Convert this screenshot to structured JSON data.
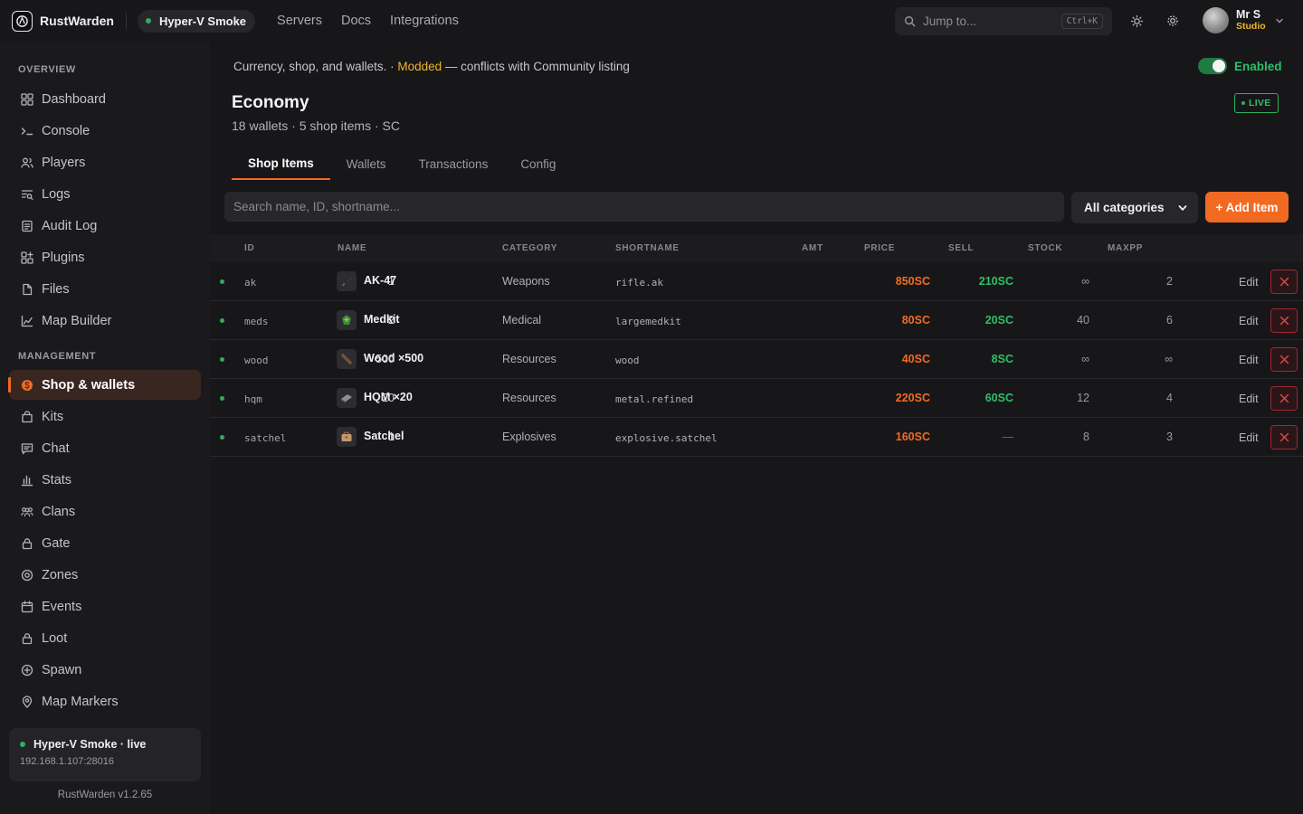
{
  "app": {
    "name": "RustWarden",
    "version": "RustWarden v1.2.65"
  },
  "header": {
    "server_name": "Hyper-V Smoke",
    "nav": [
      "Servers",
      "Docs",
      "Integrations"
    ],
    "jump_placeholder": "Jump to...",
    "jump_shortcut": "Ctrl+K",
    "user": {
      "name": "Mr S",
      "role": "Studio"
    }
  },
  "sidebar": {
    "overview_label": "OVERVIEW",
    "overview_items": [
      {
        "label": "Dashboard",
        "icon": "grid-icon"
      },
      {
        "label": "Console",
        "icon": "terminal-icon"
      },
      {
        "label": "Players",
        "icon": "users-icon"
      },
      {
        "label": "Logs",
        "icon": "logs-search-icon"
      },
      {
        "label": "Audit Log",
        "icon": "clipboard-icon"
      },
      {
        "label": "Plugins",
        "icon": "plugins-grid-icon"
      },
      {
        "label": "Files",
        "icon": "file-icon"
      },
      {
        "label": "Map Builder",
        "icon": "line-chart-icon"
      }
    ],
    "management_label": "MANAGEMENT",
    "management_items": [
      {
        "label": "Shop & wallets",
        "icon": "coin-icon",
        "active": true
      },
      {
        "label": "Kits",
        "icon": "bag-icon"
      },
      {
        "label": "Chat",
        "icon": "chat-icon"
      },
      {
        "label": "Stats",
        "icon": "bar-chart-icon"
      },
      {
        "label": "Clans",
        "icon": "group-icon"
      },
      {
        "label": "Gate",
        "icon": "lock-icon"
      },
      {
        "label": "Zones",
        "icon": "target-icon"
      },
      {
        "label": "Events",
        "icon": "calendar-icon"
      },
      {
        "label": "Loot",
        "icon": "lock-icon"
      },
      {
        "label": "Spawn",
        "icon": "plus-circle-icon"
      },
      {
        "label": "Map Markers",
        "icon": "map-pin-icon"
      }
    ],
    "status": {
      "title": "Hyper-V Smoke · live",
      "address": "192.168.1.107:28016"
    }
  },
  "page": {
    "description_prefix": "Currency, shop, and wallets. · ",
    "description_modded": "Modded",
    "description_suffix": " — conflicts with Community listing",
    "toggle_label": "Enabled",
    "title": "Economy",
    "subtitle": "18 wallets · 5 shop items · SC",
    "live_badge": "LIVE",
    "tabs": [
      "Shop Items",
      "Wallets",
      "Transactions",
      "Config"
    ],
    "search_placeholder": "Search name, ID, shortname...",
    "category_filter": "All categories",
    "add_button": "+ Add Item"
  },
  "table": {
    "columns": {
      "id": "ID",
      "name": "NAME",
      "category": "CATEGORY",
      "shortname": "SHORTNAME",
      "amt": "AMT",
      "price": "PRICE",
      "sell": "SELL",
      "stock": "STOCK",
      "maxpp": "MAXPP"
    },
    "edit_label": "Edit",
    "rows": [
      {
        "id": "ak",
        "name": "AK-47",
        "category": "Weapons",
        "shortname": "rifle.ak",
        "amt": "1",
        "price": "850SC",
        "sell": "210SC",
        "stock": "∞",
        "maxpp": "2",
        "icon": "rifle-icon"
      },
      {
        "id": "meds",
        "name": "Medkit",
        "category": "Medical",
        "shortname": "largemedkit",
        "amt": "2",
        "price": "80SC",
        "sell": "20SC",
        "stock": "40",
        "maxpp": "6",
        "icon": "medkit-icon"
      },
      {
        "id": "wood",
        "name": "Wood ×500",
        "category": "Resources",
        "shortname": "wood",
        "amt": "500",
        "price": "40SC",
        "sell": "8SC",
        "stock": "∞",
        "maxpp": "∞",
        "icon": "wood-icon"
      },
      {
        "id": "hqm",
        "name": "HQM ×20",
        "category": "Resources",
        "shortname": "metal.refined",
        "amt": "20",
        "price": "220SC",
        "sell": "60SC",
        "stock": "12",
        "maxpp": "4",
        "icon": "metal-icon"
      },
      {
        "id": "satchel",
        "name": "Satchel",
        "category": "Explosives",
        "shortname": "explosive.satchel",
        "amt": "1",
        "price": "160SC",
        "sell": "—",
        "stock": "8",
        "maxpp": "3",
        "icon": "satchel-icon"
      }
    ]
  },
  "colors": {
    "accent": "#f26a21",
    "success": "#2fbf66",
    "warning": "#f0b429",
    "danger": "#a2262b",
    "background": "#17171a"
  }
}
